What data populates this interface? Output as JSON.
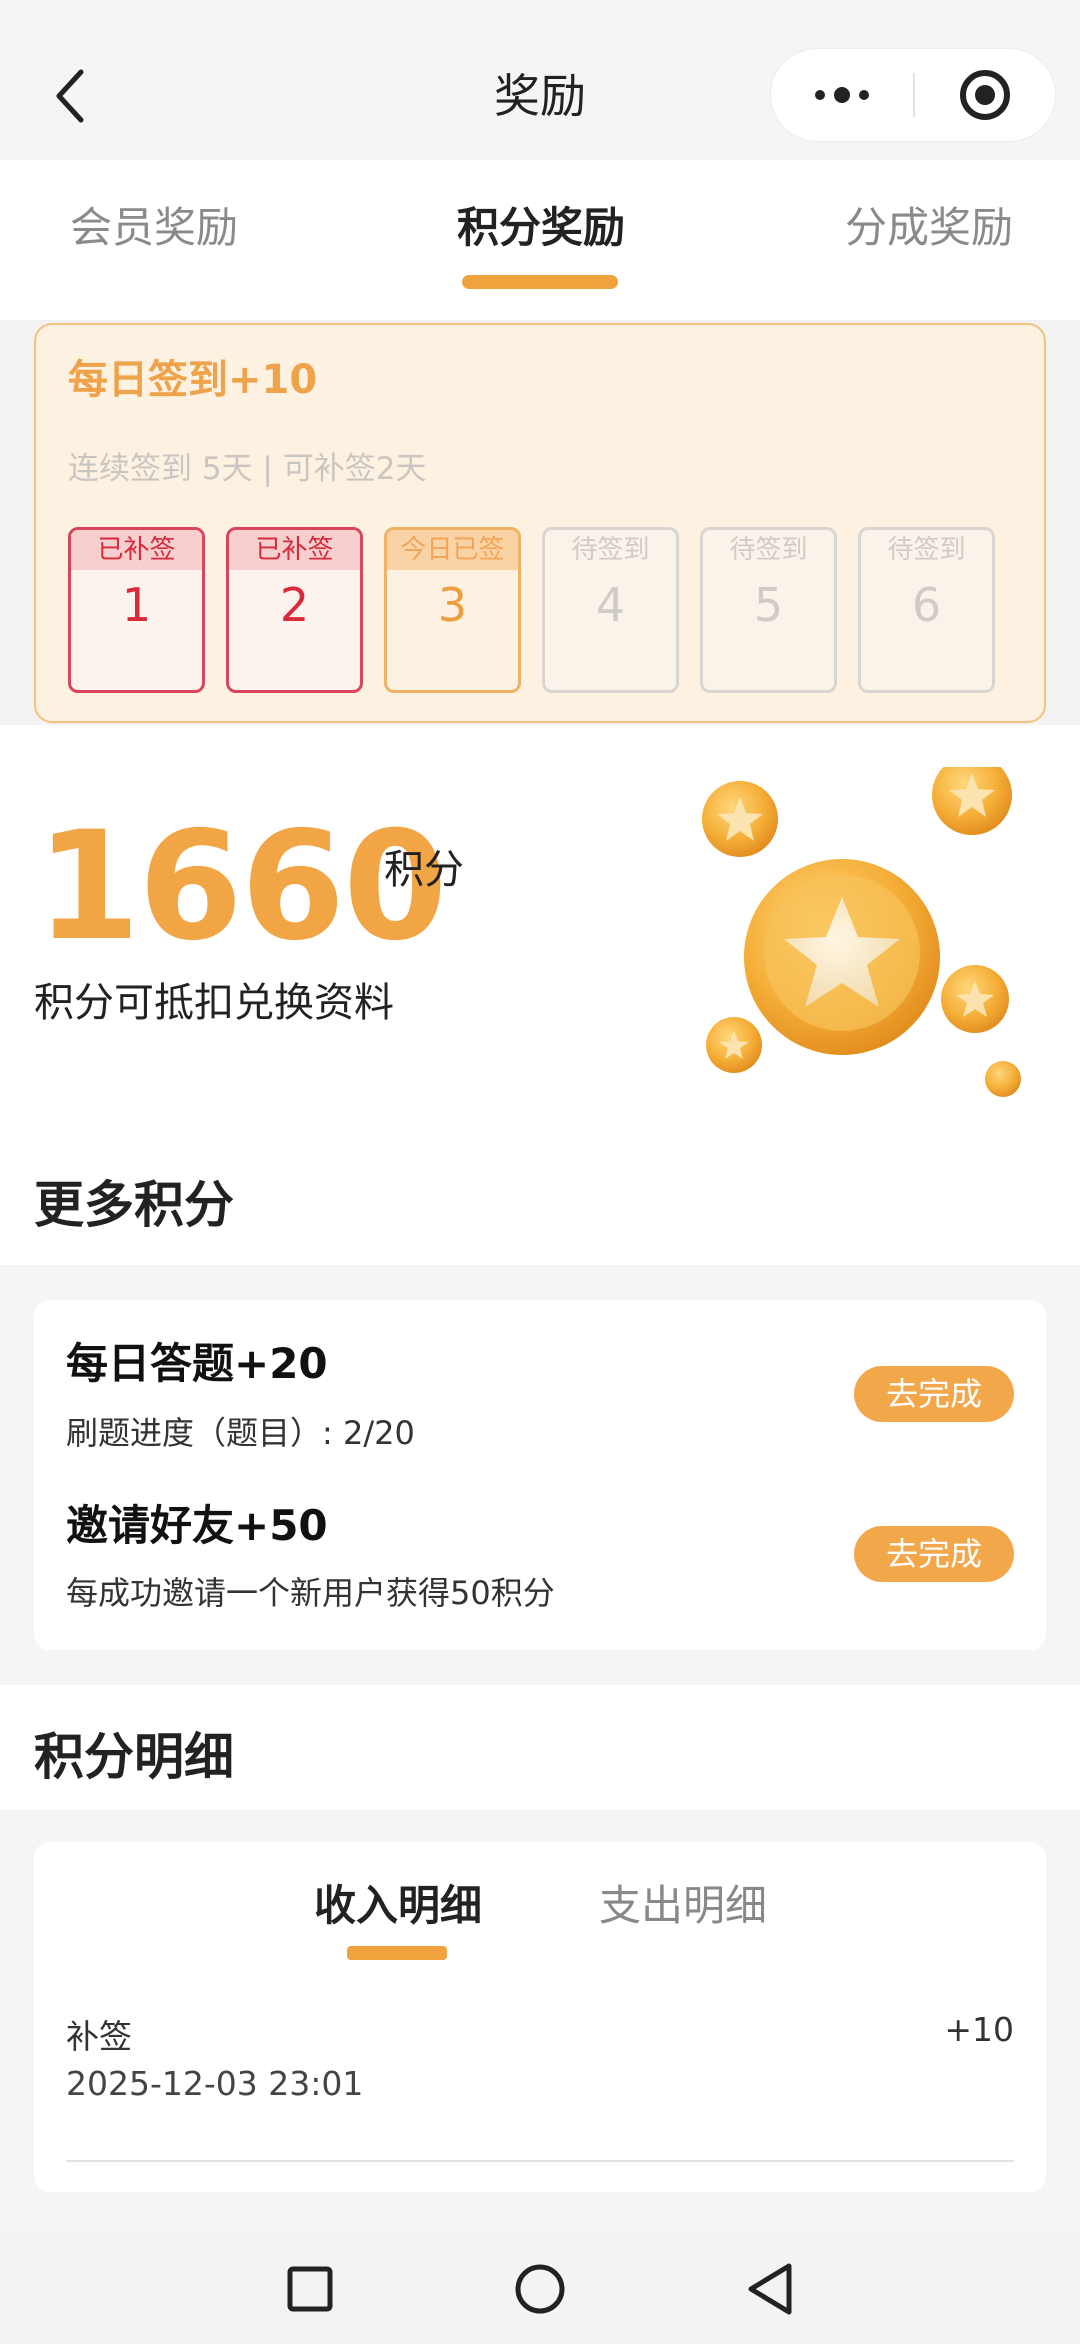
{
  "nav": {
    "title": "奖励"
  },
  "tabs": [
    {
      "label": "会员奖励",
      "active": false
    },
    {
      "label": "积分奖励",
      "active": true
    },
    {
      "label": "分成奖励",
      "active": false
    }
  ],
  "checkin": {
    "title": "每日签到+10",
    "subtitle": "连续签到 5天 | 可补签2天",
    "days": [
      {
        "status": "已补签",
        "day": "1",
        "state": "done"
      },
      {
        "status": "已补签",
        "day": "2",
        "state": "done"
      },
      {
        "status": "今日已签",
        "day": "3",
        "state": "today"
      },
      {
        "status": "待签到",
        "day": "4",
        "state": "pending"
      },
      {
        "status": "待签到",
        "day": "5",
        "state": "pending"
      },
      {
        "status": "待签到",
        "day": "6",
        "state": "pending"
      }
    ]
  },
  "points": {
    "value": "1660",
    "unit": "积分",
    "description": "积分可抵扣兑换资料"
  },
  "more_points": {
    "title": "更多积分",
    "tasks": [
      {
        "title": "每日答题+20",
        "desc": "刷题进度（题目）:  2/20",
        "button": "去完成"
      },
      {
        "title": "邀请好友+50",
        "desc": "每成功邀请一个新用户获得50积分",
        "button": "去完成"
      }
    ]
  },
  "detail": {
    "title": "积分明细",
    "tabs": [
      {
        "label": "收入明细",
        "active": true
      },
      {
        "label": "支出明细",
        "active": false
      }
    ],
    "records": [
      {
        "label": "补签",
        "time": "2025-12-03 23:01",
        "amount": "+10"
      }
    ]
  },
  "colors": {
    "accent": "#f0a33c",
    "done_red": "#d9293a",
    "card_bg": "#fdf1e2"
  }
}
